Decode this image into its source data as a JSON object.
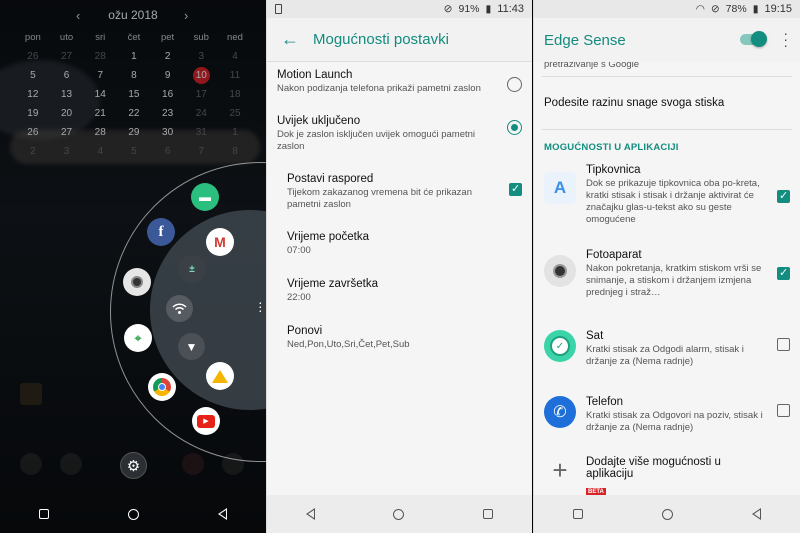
{
  "panel1": {
    "calendar": {
      "month": "ožu 2018",
      "prev": "‹",
      "next": "›",
      "weekdays": [
        "pon",
        "uto",
        "sri",
        "čet",
        "pet",
        "sub",
        "ned"
      ],
      "rows": [
        [
          "26",
          "27",
          "28",
          "1",
          "2",
          "3",
          "4"
        ],
        [
          "5",
          "6",
          "7",
          "8",
          "9",
          "10",
          "11"
        ],
        [
          "12",
          "13",
          "14",
          "15",
          "16",
          "17",
          "18"
        ],
        [
          "19",
          "20",
          "21",
          "22",
          "23",
          "24",
          "25"
        ],
        [
          "26",
          "27",
          "28",
          "29",
          "30",
          "31",
          "1"
        ],
        [
          "2",
          "3",
          "4",
          "5",
          "6",
          "7",
          "8"
        ]
      ],
      "today": "10"
    },
    "radial_apps": [
      "messages-icon",
      "facebook-icon",
      "gmail-icon",
      "camera-icon",
      "calculator-icon",
      "wifi-icon",
      "maps-icon",
      "flashlight-icon",
      "chrome-icon",
      "drive-icon",
      "youtube-icon"
    ],
    "colors": {
      "today": "#e0242c"
    }
  },
  "panel2": {
    "status": {
      "battery": "91%",
      "time": "11:43"
    },
    "title": "Mogućnosti postavki",
    "items": [
      {
        "title": "Motion Launch",
        "sub": "Nakon podizanja telefona prikaži pametni zaslon",
        "control": "radio",
        "checked": false
      },
      {
        "title": "Uvijek uključeno",
        "sub": "Dok je zaslon isključen uvijek omogući pametni zaslon",
        "control": "radio",
        "checked": true
      },
      {
        "title": "Postavi raspored",
        "sub": "Tijekom zakazanog vremena bit će prikazan pametni zaslon",
        "control": "checkbox",
        "checked": true
      },
      {
        "title": "Vrijeme početka",
        "sub": "07:00"
      },
      {
        "title": "Vrijeme završetka",
        "sub": "22:00"
      },
      {
        "title": "Ponovi",
        "sub": "Ned,Pon,Uto,Sri,Čet,Pet,Sub"
      }
    ]
  },
  "panel3": {
    "status": {
      "battery": "78%",
      "time": "19:15"
    },
    "title": "Edge Sense",
    "cut_text": "pretraživanje s Google",
    "row_plain": "Podesite razinu snage svoga stiska",
    "section": "MOGUĆNOSTI U APLIKACIJI",
    "features": [
      {
        "title": "Tipkovnica",
        "sub": "Dok se prikazuje tipkovnica oba po-kreta, kratki stisak i stisak i držanje aktivirat će značajku glas-u-tekst ako su geste omogućene",
        "checked": true,
        "icon": "keyboard-icon"
      },
      {
        "title": "Fotoaparat",
        "sub": "Nakon pokretanja, kratkim stiskom vrši se snimanje, a stiskom i držanjem izmjena prednjeg i straž…",
        "checked": true,
        "icon": "camera-icon"
      },
      {
        "title": "Sat",
        "sub": "Kratki stisak za Odgodi alarm, stisak i držanje za (Nema radnje)",
        "checked": false,
        "icon": "clock-icon"
      },
      {
        "title": "Telefon",
        "sub": "Kratki stisak za Odgovori na poziv, stisak i držanje za (Nema radnje)",
        "checked": false,
        "icon": "phone-icon"
      }
    ],
    "add_more": "Dodajte više mogućnosti u aplikaciju",
    "beta": "BETA"
  }
}
